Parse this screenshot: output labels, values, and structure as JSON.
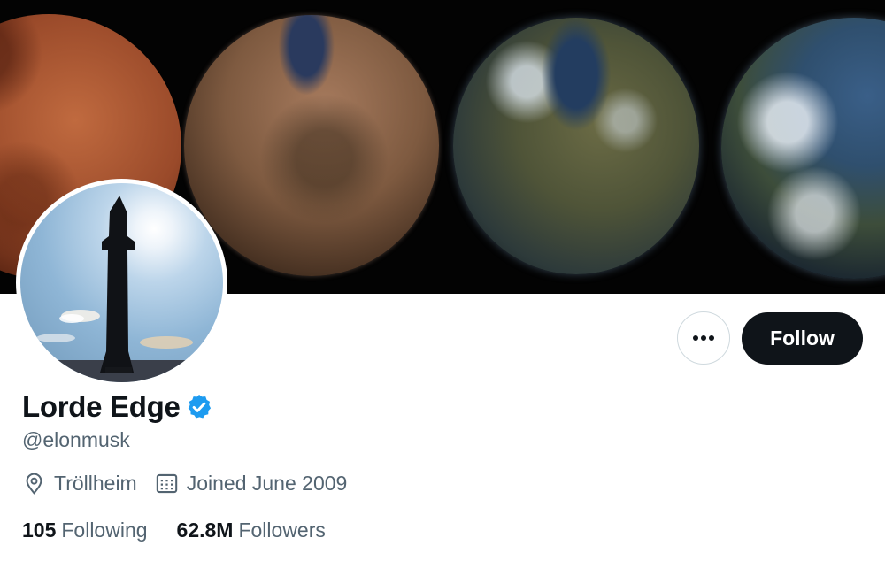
{
  "banner": {
    "icon": "planets-banner-image"
  },
  "avatar": {
    "icon": "starship-avatar-image"
  },
  "actions": {
    "more_icon": "more-horizontal-icon",
    "follow_label": "Follow"
  },
  "profile": {
    "display_name": "Lorde Edge",
    "verified_icon": "verified-badge-icon",
    "handle": "@elonmusk",
    "location": "Tröllheim",
    "location_icon": "location-pin-icon",
    "joined": "Joined June 2009",
    "joined_icon": "calendar-icon"
  },
  "stats": {
    "following_count": "105",
    "following_label": "Following",
    "followers_count": "62.8M",
    "followers_label": "Followers"
  },
  "colors": {
    "text_primary": "#0f1419",
    "text_secondary": "#536471",
    "verified_blue": "#1d9bf0",
    "follow_button_bg": "#0f1419",
    "border": "#cfd9de"
  }
}
